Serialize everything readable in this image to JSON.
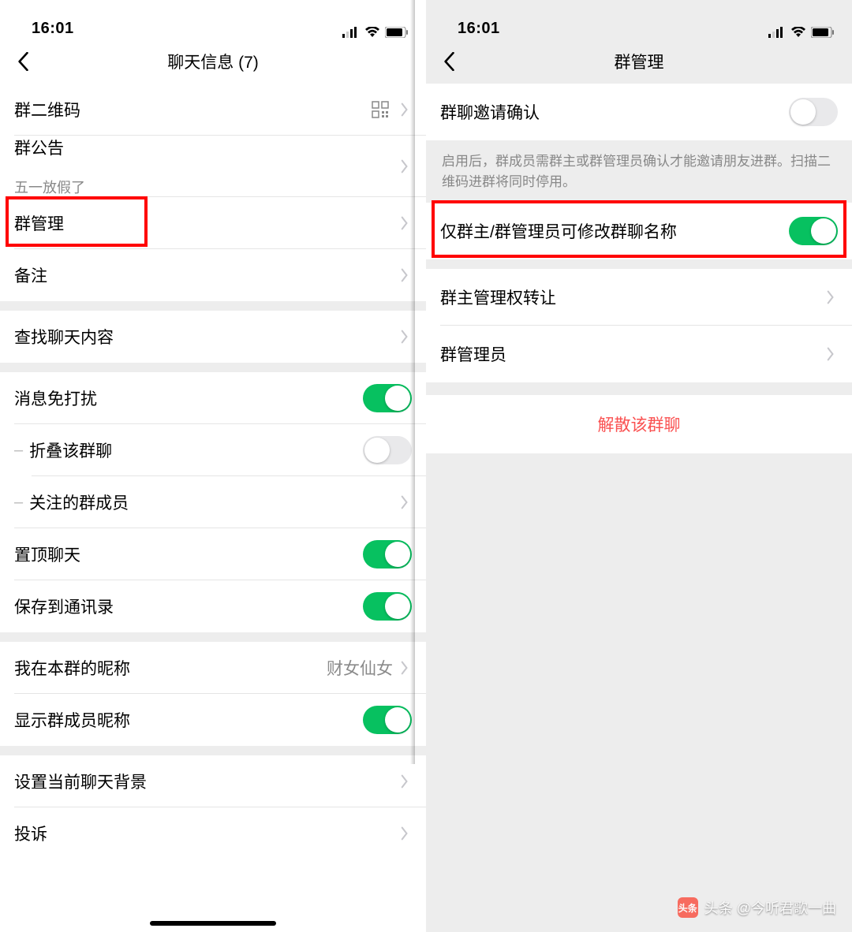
{
  "status_time": "16:01",
  "left": {
    "title": "聊天信息 (7)",
    "cells": {
      "qr": "群二维码",
      "notice": "群公告",
      "notice_sub": "五一放假了",
      "manage": "群管理",
      "remark": "备注",
      "search": "查找聊天内容",
      "mute": "消息免打扰",
      "fold": "折叠该群聊",
      "follow": "关注的群成员",
      "pin": "置顶聊天",
      "save": "保存到通讯录",
      "nickname": "我在本群的昵称",
      "nickname_value": "财女仙女",
      "show_nick": "显示群成员昵称",
      "background": "设置当前聊天背景",
      "complaint": "投诉"
    }
  },
  "right": {
    "title": "群管理",
    "cells": {
      "invite_confirm": "群聊邀请确认",
      "invite_footer": "启用后，群成员需群主或群管理员确认才能邀请朋友进群。扫描二维码进群将同时停用。",
      "only_admin_rename": "仅群主/群管理员可修改群聊名称",
      "transfer": "群主管理权转让",
      "admins": "群管理员",
      "disband": "解散该群聊"
    }
  },
  "watermark": "头条 @今听君歌一曲"
}
